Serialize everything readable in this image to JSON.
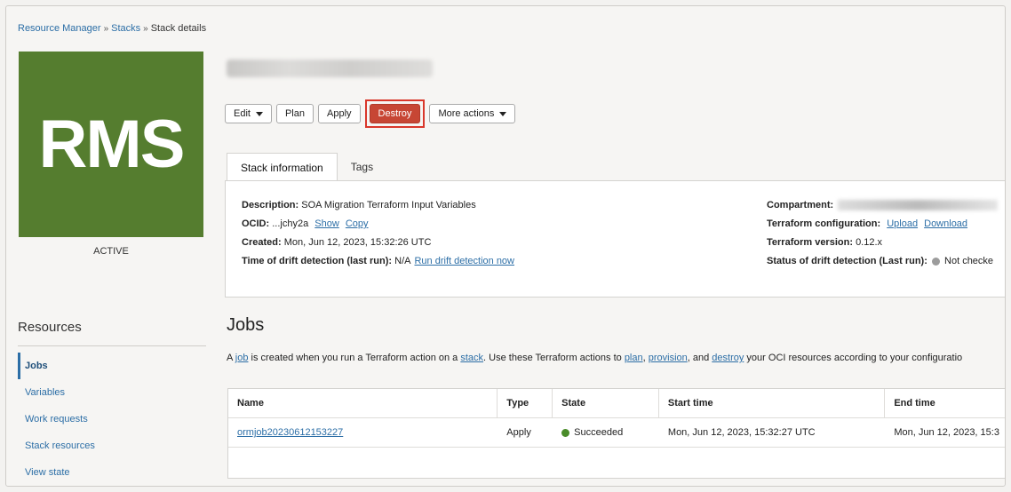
{
  "breadcrumb": {
    "item1": "Resource Manager",
    "item2": "Stacks",
    "current": "Stack details",
    "sep": "»"
  },
  "stack": {
    "logo_text": "RMS",
    "status": "ACTIVE"
  },
  "actions": {
    "edit": "Edit",
    "plan": "Plan",
    "apply": "Apply",
    "destroy": "Destroy",
    "more": "More actions"
  },
  "tabs": {
    "stack_info": "Stack information",
    "tags": "Tags"
  },
  "info": {
    "description_label": "Description:",
    "description_value": "SOA Migration Terraform Input Variables",
    "ocid_label": "OCID:",
    "ocid_value": "...jchy2a",
    "ocid_show": "Show",
    "ocid_copy": "Copy",
    "created_label": "Created:",
    "created_value": "Mon, Jun 12, 2023, 15:32:26 UTC",
    "drift_label": "Time of drift detection (last run):",
    "drift_value": "N/A",
    "drift_link": "Run drift detection now",
    "compartment_label": "Compartment:",
    "tfconfig_label": "Terraform configuration:",
    "tfconfig_upload": "Upload",
    "tfconfig_download": "Download",
    "tfversion_label": "Terraform version:",
    "tfversion_value": "0.12.x",
    "drift_status_label": "Status of drift detection (Last run):",
    "drift_status_value": "Not checke"
  },
  "resources": {
    "title": "Resources",
    "items": [
      "Jobs",
      "Variables",
      "Work requests",
      "Stack resources",
      "View state"
    ]
  },
  "jobs": {
    "title": "Jobs",
    "desc_1": "A ",
    "desc_job": "job",
    "desc_2": " is created when you run a Terraform action on a ",
    "desc_stack": "stack",
    "desc_3": ". Use these Terraform actions to ",
    "desc_plan": "plan",
    "desc_4": ", ",
    "desc_provision": "provision",
    "desc_5": ", and ",
    "desc_destroy": "destroy",
    "desc_6": " your OCI resources according to your configuratio",
    "columns": [
      "Name",
      "Type",
      "State",
      "Start time",
      "End time"
    ],
    "rows": [
      {
        "name": "ormjob20230612153227",
        "type": "Apply",
        "state": "Succeeded",
        "start": "Mon, Jun 12, 2023, 15:32:27 UTC",
        "end": "Mon, Jun 12, 2023, 15:3"
      }
    ]
  },
  "colors": {
    "accent": "#2c6ea6",
    "logo_bg": "#557d2f",
    "danger": "#c74634",
    "highlight": "#d9372b",
    "success": "#4a8c2a"
  }
}
